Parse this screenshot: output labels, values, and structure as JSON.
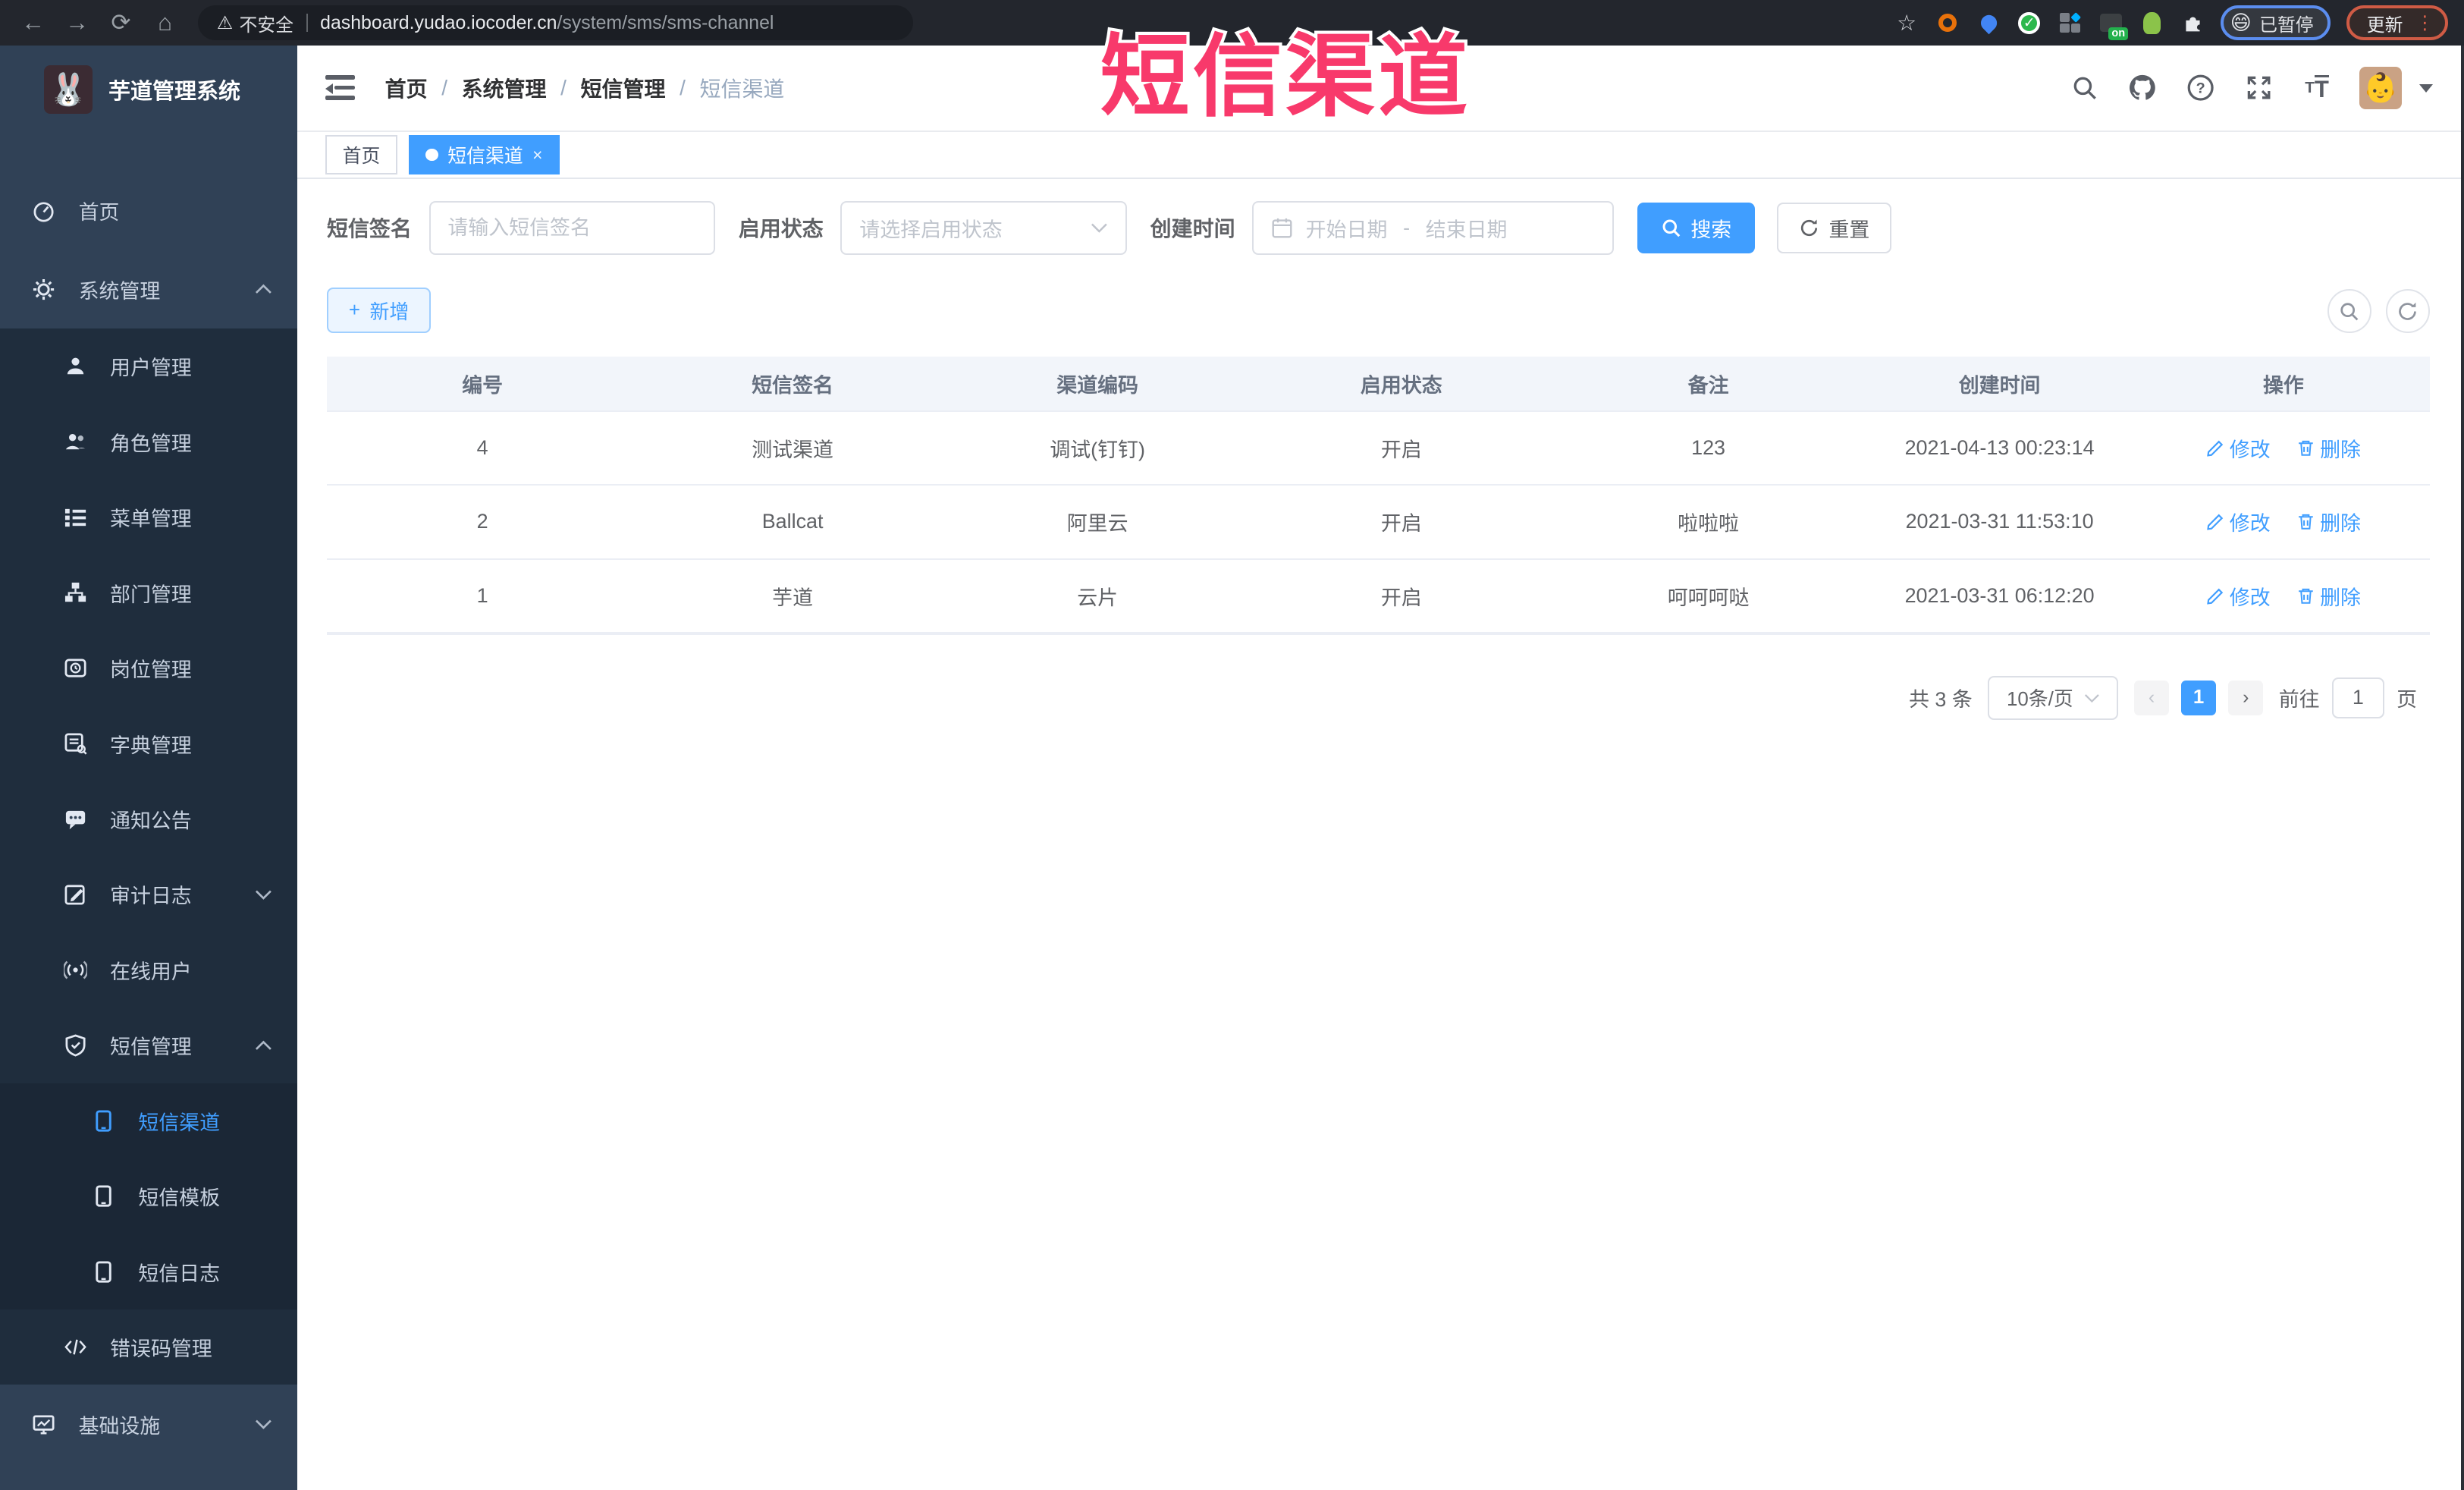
{
  "overlay": {
    "title": "短信渠道",
    "color": "#f8396b"
  },
  "browser": {
    "security_warning": "不安全",
    "url_domain": "dashboard.yudao.iocoder.cn",
    "url_path": "/system/sms/sms-channel",
    "profile_chip": {
      "emoji": "😄",
      "label": "已暂停"
    },
    "update_button": "更新",
    "icons": [
      "back-arrow",
      "forward-arrow",
      "reload",
      "home",
      "bookmark-star",
      "extension-orange-ring",
      "extension-blue-pin",
      "extension-green-check",
      "extension-grid",
      "extension-on-badge",
      "extension-green-figure",
      "extensions-puzzle",
      "kebab-menu"
    ]
  },
  "sidebar": {
    "logo_title": "芋道管理系统",
    "items": [
      {
        "label": "首页",
        "level": 1
      },
      {
        "label": "系统管理",
        "level": 1,
        "state": "expanded"
      },
      {
        "label": "用户管理",
        "level": 2
      },
      {
        "label": "角色管理",
        "level": 2
      },
      {
        "label": "菜单管理",
        "level": 2
      },
      {
        "label": "部门管理",
        "level": 2
      },
      {
        "label": "岗位管理",
        "level": 2
      },
      {
        "label": "字典管理",
        "level": 2
      },
      {
        "label": "通知公告",
        "level": 2
      },
      {
        "label": "审计日志",
        "level": 2,
        "state": "collapsed"
      },
      {
        "label": "在线用户",
        "level": 2
      },
      {
        "label": "短信管理",
        "level": 2,
        "state": "expanded"
      },
      {
        "label": "短信渠道",
        "level": 3,
        "active": true
      },
      {
        "label": "短信模板",
        "level": 3
      },
      {
        "label": "短信日志",
        "level": 3
      },
      {
        "label": "错误码管理",
        "level": 2
      },
      {
        "label": "基础设施",
        "level": 1,
        "state": "collapsed"
      }
    ]
  },
  "navbar": {
    "breadcrumb": [
      "首页",
      "系统管理",
      "短信管理",
      "短信渠道"
    ],
    "separator": "/",
    "icons": [
      "search-icon",
      "github-icon",
      "help-icon",
      "fullscreen-icon",
      "font-size-icon",
      "avatar",
      "caret-down"
    ]
  },
  "tags": [
    {
      "label": "首页",
      "active": false
    },
    {
      "label": "短信渠道",
      "active": true,
      "closable": true
    }
  ],
  "filters": {
    "sign": {
      "label": "短信签名",
      "placeholder": "请输入短信签名"
    },
    "status": {
      "label": "启用状态",
      "placeholder": "请选择启用状态"
    },
    "time": {
      "label": "创建时间",
      "start_placeholder": "开始日期",
      "separator": "-",
      "end_placeholder": "结束日期"
    },
    "search_button": "搜索",
    "reset_button": "重置"
  },
  "toolbar": {
    "add_button": "新增",
    "plus": "+",
    "icon_buttons": [
      "search-toggle-icon",
      "refresh-icon"
    ]
  },
  "table": {
    "headers": [
      "编号",
      "短信签名",
      "渠道编码",
      "启用状态",
      "备注",
      "创建时间",
      "操作"
    ],
    "edit_label": "修改",
    "delete_label": "删除",
    "rows": [
      {
        "id": "4",
        "sign": "测试渠道",
        "code": "调试(钉钉)",
        "status": "开启",
        "remark": "123",
        "created": "2021-04-13 00:23:14"
      },
      {
        "id": "2",
        "sign": "Ballcat",
        "code": "阿里云",
        "status": "开启",
        "remark": "啦啦啦",
        "created": "2021-03-31 11:53:10"
      },
      {
        "id": "1",
        "sign": "芋道",
        "code": "云片",
        "status": "开启",
        "remark": "呵呵呵哒",
        "created": "2021-03-31 06:12:20"
      }
    ]
  },
  "pagination": {
    "total": "共 3 条",
    "page_size": "10条/页",
    "current_page": "1",
    "goto_label": "前往",
    "goto_value": "1",
    "page_unit": "页"
  },
  "colors": {
    "accent": "#409eff",
    "overlay_pink": "#f8396b",
    "sidebar_bg": "#304156",
    "submenu_bg": "#1f2d3d",
    "header_bg": "#f2f5fa"
  }
}
